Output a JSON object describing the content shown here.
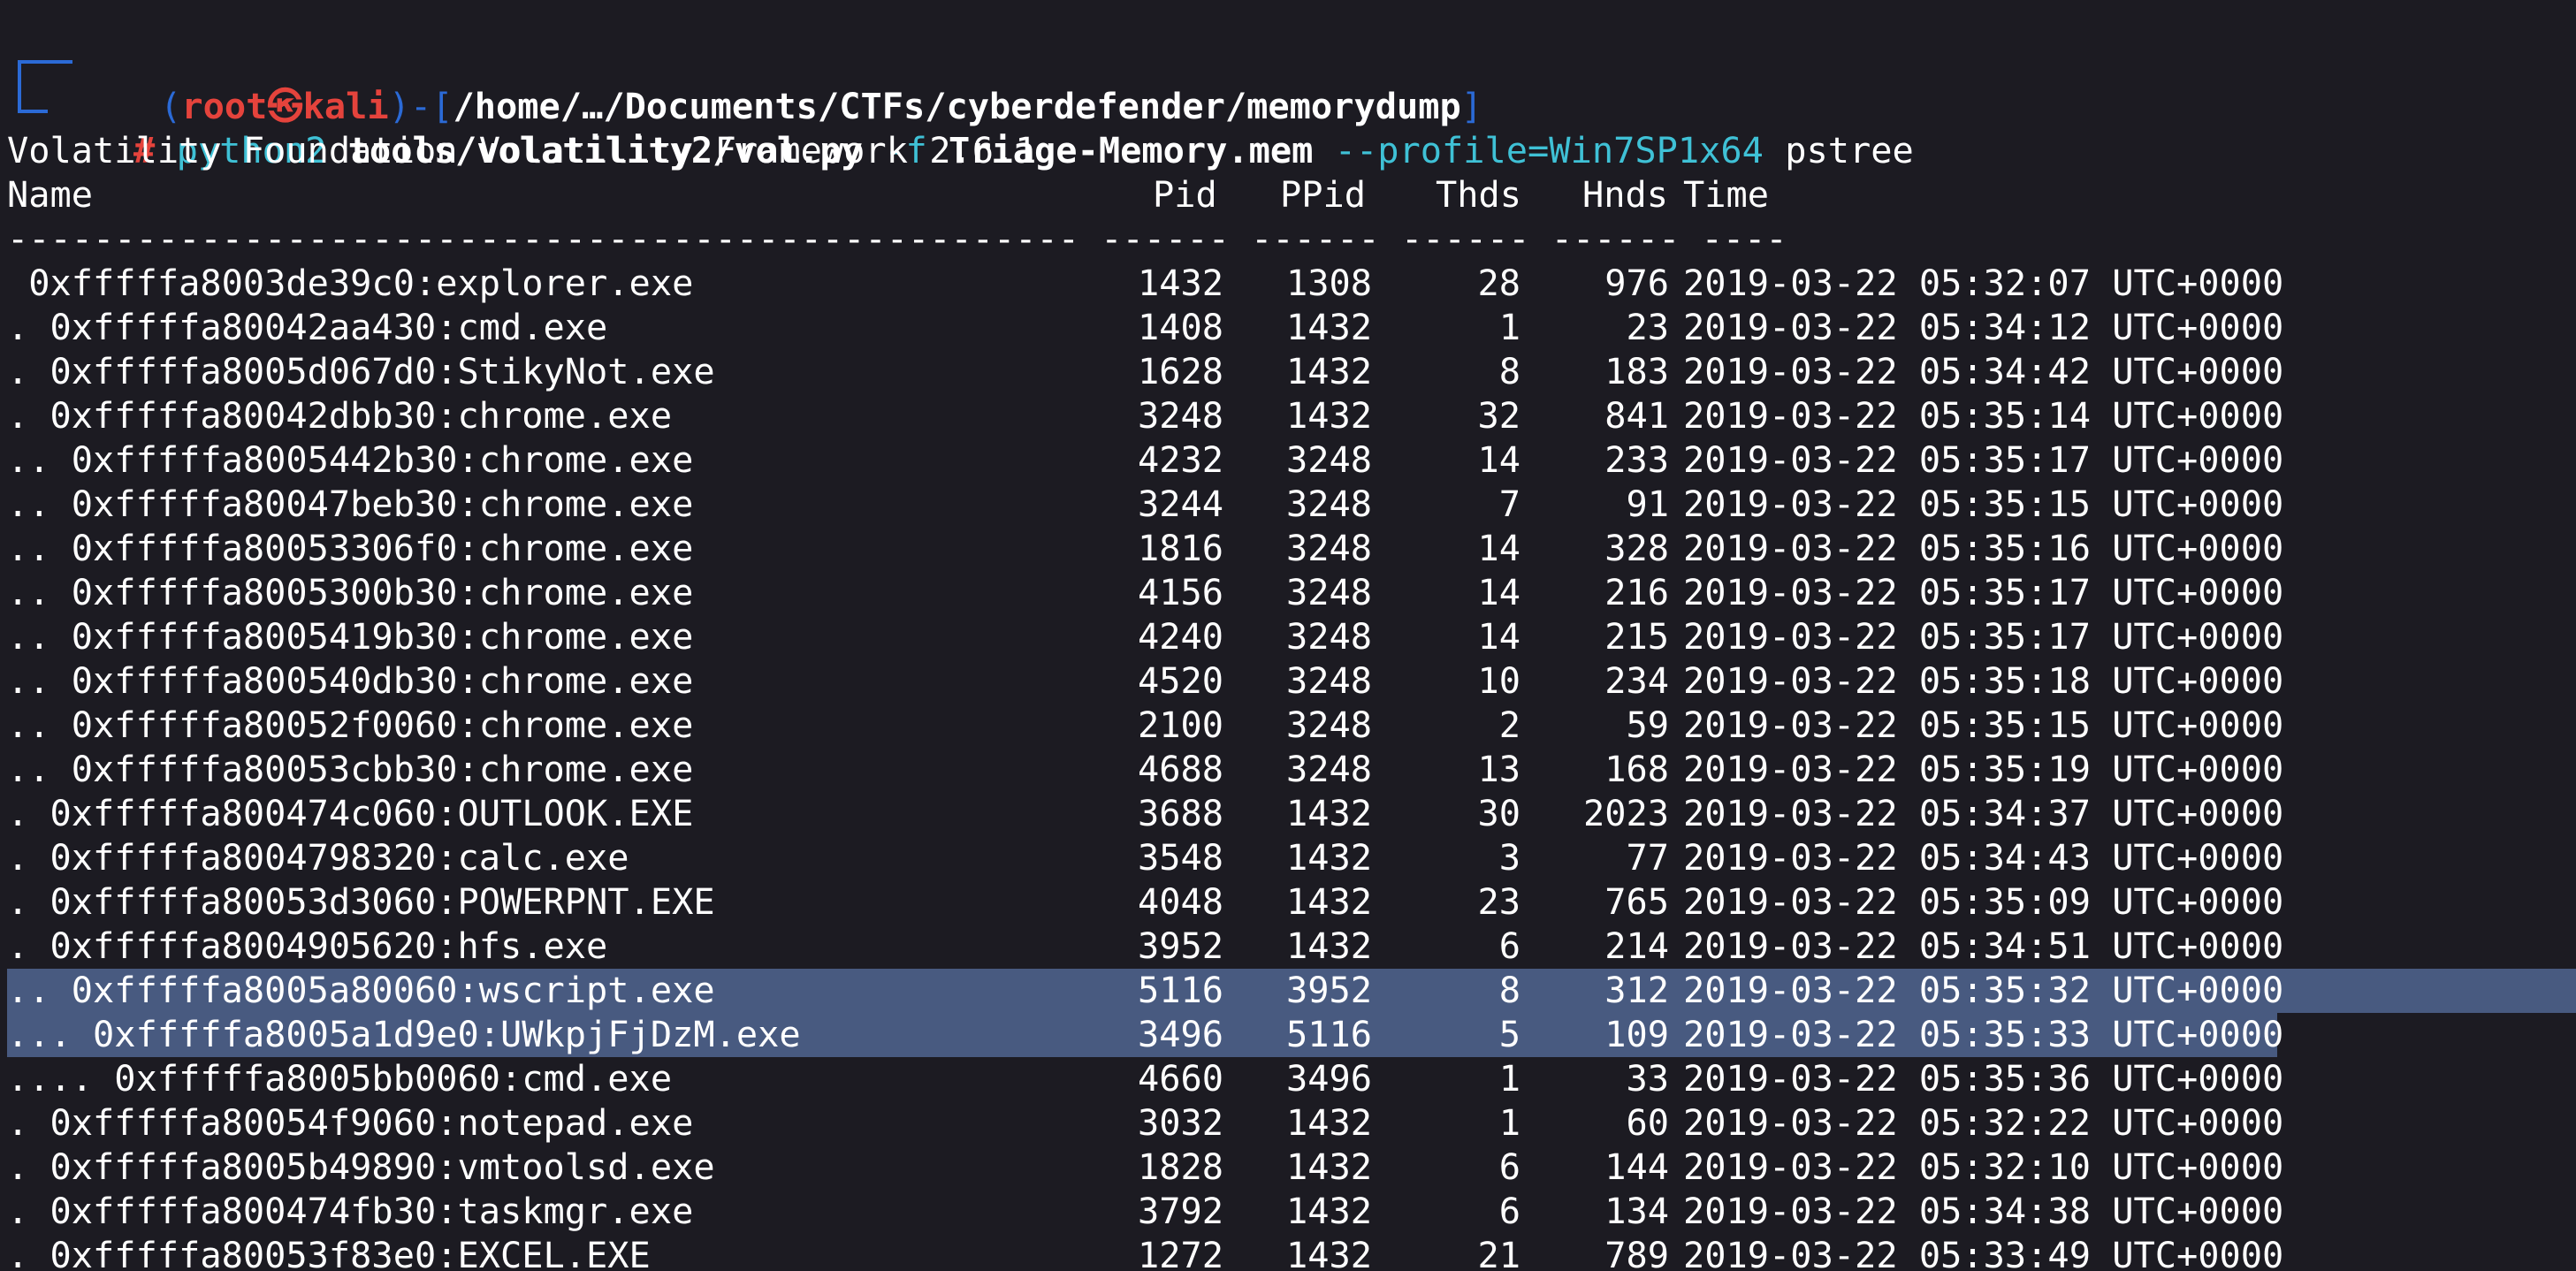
{
  "prompt": {
    "open": "(",
    "user": "root㉿kali",
    "close": ")-[",
    "cwd": "/home/…/Documents/CTFs/cyberdefender/memorydump",
    "end": "]",
    "hash": "#",
    "cmd_python": "python2",
    "cmd_script": "tools/volatility2/vol.py",
    "cmd_flag_f": "-f",
    "cmd_file": "Triage-Memory.mem",
    "cmd_profile": "--profile=Win7SP1x64",
    "cmd_plugin": "pstree"
  },
  "banner": "Volatility Foundation Volatility Framework 2.6.1",
  "headers": {
    "name": "Name",
    "pid": "Pid",
    "ppid": "PPid",
    "thds": "Thds",
    "hnds": "Hnds",
    "time": "Time"
  },
  "separator": "-------------------------------------------------- ------ ------ ------ ------ ----",
  "rows": [
    {
      "name": " 0xfffffa8003de39c0:explorer.exe",
      "pid": "1432",
      "ppid": "1308",
      "thds": "28",
      "hnds": "976",
      "time": "2019-03-22 05:32:07 UTC+0000"
    },
    {
      "name": ". 0xfffffa80042aa430:cmd.exe",
      "pid": "1408",
      "ppid": "1432",
      "thds": "1",
      "hnds": "23",
      "time": "2019-03-22 05:34:12 UTC+0000"
    },
    {
      "name": ". 0xfffffa8005d067d0:StikyNot.exe",
      "pid": "1628",
      "ppid": "1432",
      "thds": "8",
      "hnds": "183",
      "time": "2019-03-22 05:34:42 UTC+0000"
    },
    {
      "name": ". 0xfffffa80042dbb30:chrome.exe",
      "pid": "3248",
      "ppid": "1432",
      "thds": "32",
      "hnds": "841",
      "time": "2019-03-22 05:35:14 UTC+0000"
    },
    {
      "name": ".. 0xfffffa8005442b30:chrome.exe",
      "pid": "4232",
      "ppid": "3248",
      "thds": "14",
      "hnds": "233",
      "time": "2019-03-22 05:35:17 UTC+0000"
    },
    {
      "name": ".. 0xfffffa80047beb30:chrome.exe",
      "pid": "3244",
      "ppid": "3248",
      "thds": "7",
      "hnds": "91",
      "time": "2019-03-22 05:35:15 UTC+0000"
    },
    {
      "name": ".. 0xfffffa80053306f0:chrome.exe",
      "pid": "1816",
      "ppid": "3248",
      "thds": "14",
      "hnds": "328",
      "time": "2019-03-22 05:35:16 UTC+0000"
    },
    {
      "name": ".. 0xfffffa8005300b30:chrome.exe",
      "pid": "4156",
      "ppid": "3248",
      "thds": "14",
      "hnds": "216",
      "time": "2019-03-22 05:35:17 UTC+0000"
    },
    {
      "name": ".. 0xfffffa8005419b30:chrome.exe",
      "pid": "4240",
      "ppid": "3248",
      "thds": "14",
      "hnds": "215",
      "time": "2019-03-22 05:35:17 UTC+0000"
    },
    {
      "name": ".. 0xfffffa800540db30:chrome.exe",
      "pid": "4520",
      "ppid": "3248",
      "thds": "10",
      "hnds": "234",
      "time": "2019-03-22 05:35:18 UTC+0000"
    },
    {
      "name": ".. 0xfffffa80052f0060:chrome.exe",
      "pid": "2100",
      "ppid": "3248",
      "thds": "2",
      "hnds": "59",
      "time": "2019-03-22 05:35:15 UTC+0000"
    },
    {
      "name": ".. 0xfffffa80053cbb30:chrome.exe",
      "pid": "4688",
      "ppid": "3248",
      "thds": "13",
      "hnds": "168",
      "time": "2019-03-22 05:35:19 UTC+0000"
    },
    {
      "name": ". 0xfffffa800474c060:OUTLOOK.EXE",
      "pid": "3688",
      "ppid": "1432",
      "thds": "30",
      "hnds": "2023",
      "time": "2019-03-22 05:34:37 UTC+0000"
    },
    {
      "name": ". 0xfffffa8004798320:calc.exe",
      "pid": "3548",
      "ppid": "1432",
      "thds": "3",
      "hnds": "77",
      "time": "2019-03-22 05:34:43 UTC+0000"
    },
    {
      "name": ". 0xfffffa80053d3060:POWERPNT.EXE",
      "pid": "4048",
      "ppid": "1432",
      "thds": "23",
      "hnds": "765",
      "time": "2019-03-22 05:35:09 UTC+0000"
    },
    {
      "name": ". 0xfffffa8004905620:hfs.exe",
      "pid": "3952",
      "ppid": "1432",
      "thds": "6",
      "hnds": "214",
      "time": "2019-03-22 05:34:51 UTC+0000"
    },
    {
      "name": ".. 0xfffffa8005a80060:wscript.exe",
      "pid": "5116",
      "ppid": "3952",
      "thds": "8",
      "hnds": "312",
      "time": "2019-03-22 05:35:32 UTC+0000"
    },
    {
      "name": "... 0xfffffa8005a1d9e0:UWkpjFjDzM.exe",
      "pid": "3496",
      "ppid": "5116",
      "thds": "5",
      "hnds": "109",
      "time": "2019-03-22 05:35:33 UTC+0000"
    },
    {
      "name": ".... 0xfffffa8005bb0060:cmd.exe",
      "pid": "4660",
      "ppid": "3496",
      "thds": "1",
      "hnds": "33",
      "time": "2019-03-22 05:35:36 UTC+0000"
    },
    {
      "name": ". 0xfffffa80054f9060:notepad.exe",
      "pid": "3032",
      "ppid": "1432",
      "thds": "1",
      "hnds": "60",
      "time": "2019-03-22 05:32:22 UTC+0000"
    },
    {
      "name": ". 0xfffffa8005b49890:vmtoolsd.exe",
      "pid": "1828",
      "ppid": "1432",
      "thds": "6",
      "hnds": "144",
      "time": "2019-03-22 05:32:10 UTC+0000"
    },
    {
      "name": ". 0xfffffa800474fb30:taskmgr.exe",
      "pid": "3792",
      "ppid": "1432",
      "thds": "6",
      "hnds": "134",
      "time": "2019-03-22 05:34:38 UTC+0000"
    },
    {
      "name": ". 0xfffffa80053f83e0:EXCEL.EXE",
      "pid": "1272",
      "ppid": "1432",
      "thds": "21",
      "hnds": "789",
      "time": "2019-03-22 05:33:49 UTC+0000"
    }
  ],
  "selection": {
    "first_row": "wscript.exe",
    "last_row": "UWkpjFjDzM.exe"
  },
  "colors": {
    "background": "#1c1b22",
    "prompt_frame": "#2b6ad6",
    "prompt_user": "#e5433c",
    "command_accent": "#3fc1d6",
    "selection": "#485a80"
  }
}
